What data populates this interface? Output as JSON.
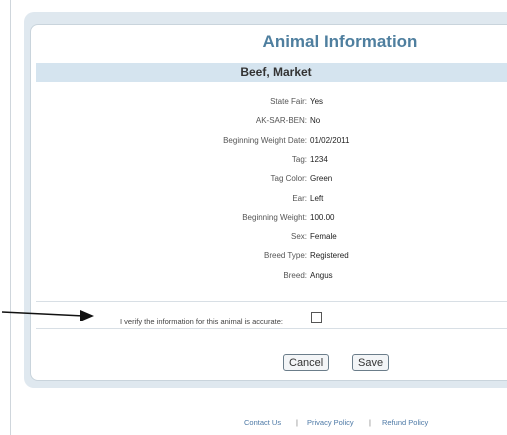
{
  "panel": {
    "title": "Animal Information",
    "subtitle": "Beef, Market"
  },
  "fields": [
    {
      "label": "State Fair:",
      "value": "Yes"
    },
    {
      "label": "AK-SAR-BEN:",
      "value": "No"
    },
    {
      "label": "Beginning Weight Date:",
      "value": "01/02/2011"
    },
    {
      "label": "Tag:",
      "value": "1234"
    },
    {
      "label": "Tag Color:",
      "value": "Green"
    },
    {
      "label": "Ear:",
      "value": "Left"
    },
    {
      "label": "Beginning Weight:",
      "value": "100.00"
    },
    {
      "label": "Sex:",
      "value": "Female"
    },
    {
      "label": "Breed Type:",
      "value": "Registered"
    },
    {
      "label": "Breed:",
      "value": "Angus"
    }
  ],
  "verify": {
    "label": "I verify the information for this animal is accurate:",
    "checked": false
  },
  "buttons": {
    "cancel": "Cancel",
    "save": "Save"
  },
  "footer": {
    "contact": "Contact Us",
    "privacy": "Privacy Policy",
    "refund": "Refund Policy",
    "separator": "|"
  }
}
